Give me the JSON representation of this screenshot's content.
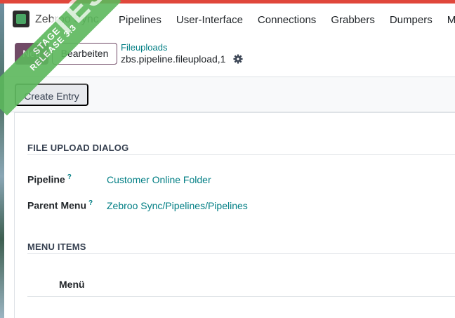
{
  "navbar": {
    "app_name": "Zebroo Sync",
    "menu_items": [
      "Pipelines",
      "User-Interface",
      "Connections",
      "Grabbers",
      "Dumpers",
      "Ma"
    ]
  },
  "control_panel": {
    "new_label": "Neu",
    "edit_label": "Bearbeiten",
    "breadcrumb_parent": "Fileuploads",
    "breadcrumb_current": "zbs.pipeline.fileupload,1"
  },
  "statusbar": {
    "create_entry_label": "Create Entry"
  },
  "form": {
    "section1_title": "FILE UPLOAD DIALOG",
    "fields": [
      {
        "label": "Pipeline",
        "help": "?",
        "value": "Customer Online Folder"
      },
      {
        "label": "Parent Menu",
        "help": "?",
        "value": "Zebroo Sync/Pipelines/Pipelines"
      }
    ],
    "section2_title": "MENU ITEMS",
    "menu_items_column": "Menü"
  },
  "ribbon": {
    "line1": "STAGE",
    "line2": "RELEASE 3.3",
    "watermark": "TEST"
  },
  "colors": {
    "topstrip": "#e0473b",
    "ribbon": "#5cb85c",
    "link": "#017e84",
    "primary": "#714b67"
  }
}
